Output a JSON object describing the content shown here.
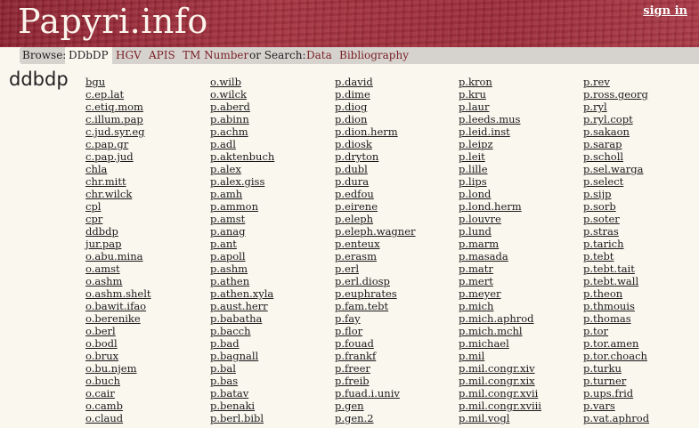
{
  "site": {
    "logo": "Papyri.info",
    "signin": "sign in"
  },
  "nav": {
    "browse_label": "Browse:",
    "browse_items": [
      "DDbDP",
      "HGV",
      "APIS",
      "TM Number"
    ],
    "search_label": "or Search:",
    "search_items": [
      "Data",
      "Bibliography"
    ]
  },
  "page_title": "ddbdp",
  "columns": [
    [
      "bgu",
      "c.ep.lat",
      "c.etiq.mom",
      "c.illum.pap",
      "c.jud.syr.eg",
      "c.pap.gr",
      "c.pap.jud",
      "chla",
      "chr.mitt",
      "chr.wilck",
      "cpl",
      "cpr",
      "ddbdp",
      "jur.pap",
      "o.abu.mina",
      "o.amst",
      "o.ashm",
      "o.ashm.shelt",
      "o.bawit.ifao",
      "o.berenike",
      "o.berl",
      "o.bodl",
      "o.brux",
      "o.bu.njem",
      "o.buch",
      "o.cair",
      "o.camb",
      "o.claud"
    ],
    [
      "o.wilb",
      "o.wilck",
      "p.aberd",
      "p.abinn",
      "p.achm",
      "p.adl",
      "p.aktenbuch",
      "p.alex",
      "p.alex.giss",
      "p.amh",
      "p.ammon",
      "p.amst",
      "p.anag",
      "p.ant",
      "p.apoll",
      "p.ashm",
      "p.athen",
      "p.athen.xyla",
      "p.aust.herr",
      "p.babatha",
      "p.bacch",
      "p.bad",
      "p.bagnall",
      "p.bal",
      "p.bas",
      "p.batav",
      "p.benaki",
      "p.berl.bibl"
    ],
    [
      "p.david",
      "p.dime",
      "p.diog",
      "p.dion",
      "p.dion.herm",
      "p.diosk",
      "p.dryton",
      "p.dubl",
      "p.dura",
      "p.edfou",
      "p.eirene",
      "p.eleph",
      "p.eleph.wagner",
      "p.enteux",
      "p.erasm",
      "p.erl",
      "p.erl.diosp",
      "p.euphrates",
      "p.fam.tebt",
      "p.fay",
      "p.flor",
      "p.fouad",
      "p.frankf",
      "p.freer",
      "p.freib",
      "p.fuad.i.univ",
      "p.gen",
      "p.gen.2"
    ],
    [
      "p.kron",
      "p.kru",
      "p.laur",
      "p.leeds.mus",
      "p.leid.inst",
      "p.leipz",
      "p.leit",
      "p.lille",
      "p.lips",
      "p.lond",
      "p.lond.herm",
      "p.louvre",
      "p.lund",
      "p.marm",
      "p.masada",
      "p.matr",
      "p.mert",
      "p.meyer",
      "p.mich",
      "p.mich.aphrod",
      "p.mich.mchl",
      "p.michael",
      "p.mil",
      "p.mil.congr.xiv",
      "p.mil.congr.xix",
      "p.mil.congr.xvii",
      "p.mil.congr.xviii",
      "p.mil.vogl"
    ],
    [
      "p.rev",
      "p.ross.georg",
      "p.ryl",
      "p.ryl.copt",
      "p.sakaon",
      "p.sarap",
      "p.scholl",
      "p.sel.warga",
      "p.select",
      "p.sijp",
      "p.sorb",
      "p.soter",
      "p.stras",
      "p.tarich",
      "p.tebt",
      "p.tebt.tait",
      "p.tebt.wall",
      "p.theon",
      "p.thmouis",
      "p.thomas",
      "p.tor",
      "p.tor.amen",
      "p.tor.choach",
      "p.turku",
      "p.turner",
      "p.ups.frid",
      "p.vars",
      "p.vat.aphrod"
    ]
  ]
}
